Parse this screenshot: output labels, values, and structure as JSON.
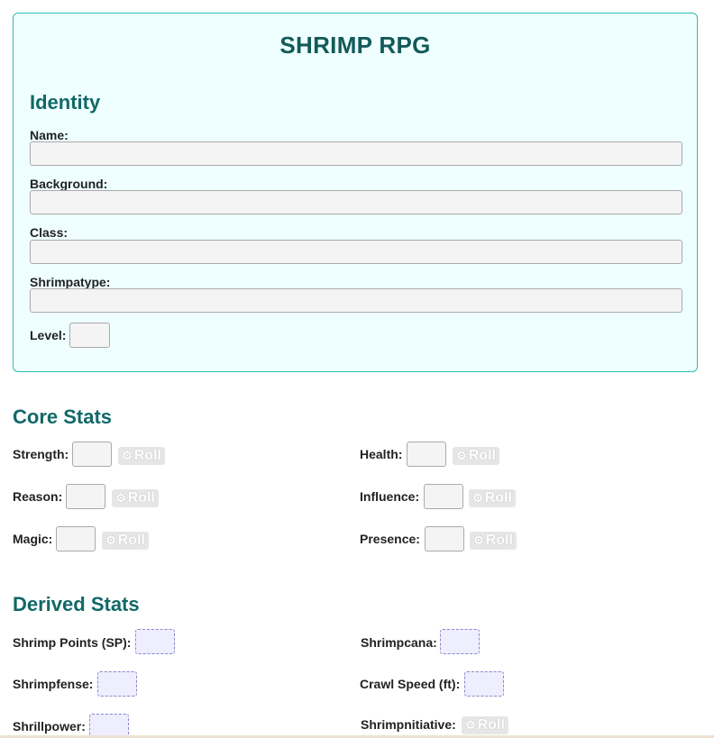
{
  "title": "SHRIMP RPG",
  "identity": {
    "heading": "Identity",
    "name_label": "Name:",
    "name_value": "",
    "background_label": "Background:",
    "background_value": "",
    "class_label": "Class:",
    "class_value": "",
    "shrimpatype_label": "Shrimpatype:",
    "shrimpatype_value": "",
    "level_label": "Level:",
    "level_value": ""
  },
  "core": {
    "heading": "Core Stats",
    "roll_label": "Roll",
    "strength_label": "Strength:",
    "health_label": "Health:",
    "reason_label": "Reason:",
    "influence_label": "Influence:",
    "magic_label": "Magic:",
    "presence_label": "Presence:"
  },
  "derived": {
    "heading": "Derived Stats",
    "sp_label": "Shrimp Points (SP):",
    "shrimpcana_label": "Shrimpcana:",
    "shrimpfense_label": "Shrimpfense:",
    "crawl_label": "Crawl Speed (ft):",
    "shrillpower_label": "Shrillpower:",
    "shrimpnitiative_label": "Shrimpnitiative:"
  },
  "colors": {
    "accent": "#126868",
    "card_bg": "#efffff",
    "card_border": "#2bbcb5",
    "derived_box_bg": "#eeeeff"
  },
  "icons": {
    "roll": "die-icon"
  }
}
